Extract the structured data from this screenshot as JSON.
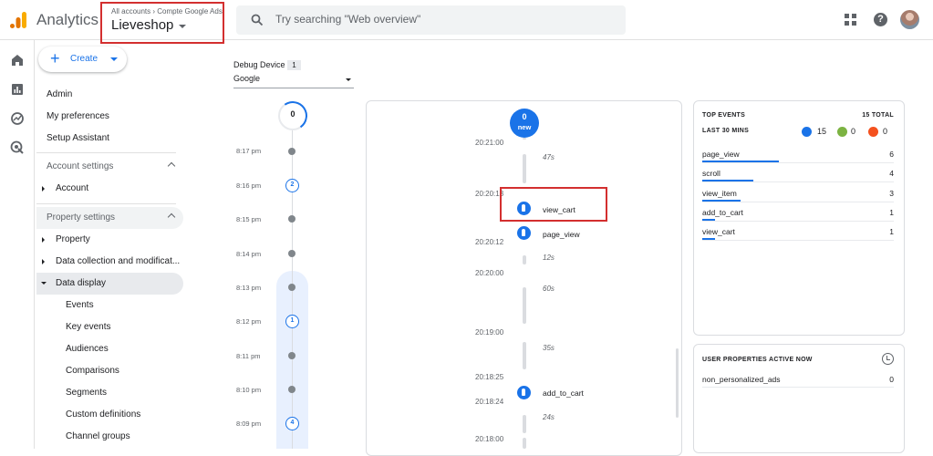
{
  "app": {
    "name": "Analytics"
  },
  "account": {
    "breadcrumb": "All accounts › Compte Google Ads",
    "property": "Lieveshop"
  },
  "search": {
    "placeholder": "Try searching \"Web overview\""
  },
  "header_icons": [
    "apps-icon",
    "help-icon",
    "avatar"
  ],
  "rail_icons": [
    "home-icon",
    "reports-icon",
    "explore-icon",
    "advertising-icon"
  ],
  "nav": {
    "create_label": "Create",
    "admin": "Admin",
    "my_preferences": "My preferences",
    "setup_assistant": "Setup Assistant",
    "account_settings": "Account settings",
    "account": "Account",
    "property_settings": "Property settings",
    "property": "Property",
    "data_collection": "Data collection and modificat...",
    "data_display": "Data display",
    "sub_items": [
      "Events",
      "Key events",
      "Audiences",
      "Comparisons",
      "Segments",
      "Custom definitions",
      "Channel groups"
    ]
  },
  "debug_device": {
    "label": "Debug Device",
    "count": "1",
    "value": "Google"
  },
  "minute_stream": {
    "current": "0",
    "rows": [
      {
        "time": "8:17 pm",
        "count": null
      },
      {
        "time": "8:16 pm",
        "count": "2"
      },
      {
        "time": "8:15 pm",
        "count": null
      },
      {
        "time": "8:14 pm",
        "count": null
      },
      {
        "time": "8:13 pm",
        "count": null
      },
      {
        "time": "8:12 pm",
        "count": "1"
      },
      {
        "time": "8:11 pm",
        "count": null
      },
      {
        "time": "8:10 pm",
        "count": null
      },
      {
        "time": "8:09 pm",
        "count": "4"
      }
    ]
  },
  "seconds_stream": {
    "new_count": "0",
    "new_label": "new",
    "times": [
      "20:21:00",
      "20:20:13",
      "20:20:12",
      "20:20:00",
      "20:19:00",
      "20:18:25",
      "20:18:24",
      "20:18:00"
    ],
    "durations": [
      "47s",
      "12s",
      "60s",
      "35s",
      "24s"
    ],
    "events": [
      "view_cart",
      "page_view",
      "add_to_cart"
    ]
  },
  "top_events": {
    "title": "TOP EVENTS",
    "total": "15 TOTAL",
    "period": "LAST 30 MINS",
    "counts": {
      "events": "15",
      "key_events": "0",
      "errors": "0"
    },
    "rows": [
      {
        "name": "page_view",
        "value": "6"
      },
      {
        "name": "scroll",
        "value": "4"
      },
      {
        "name": "view_item",
        "value": "3"
      },
      {
        "name": "add_to_cart",
        "value": "1"
      },
      {
        "name": "view_cart",
        "value": "1"
      }
    ],
    "colors": {
      "events": "#1a73e8",
      "key_events": "#7cb342",
      "errors": "#f4511e"
    }
  },
  "user_properties": {
    "title": "USER PROPERTIES ACTIVE NOW",
    "rows": [
      {
        "name": "non_personalized_ads",
        "value": "0"
      }
    ]
  },
  "colors": {
    "accent": "#1a73e8",
    "highlight": "#d32f2f"
  }
}
